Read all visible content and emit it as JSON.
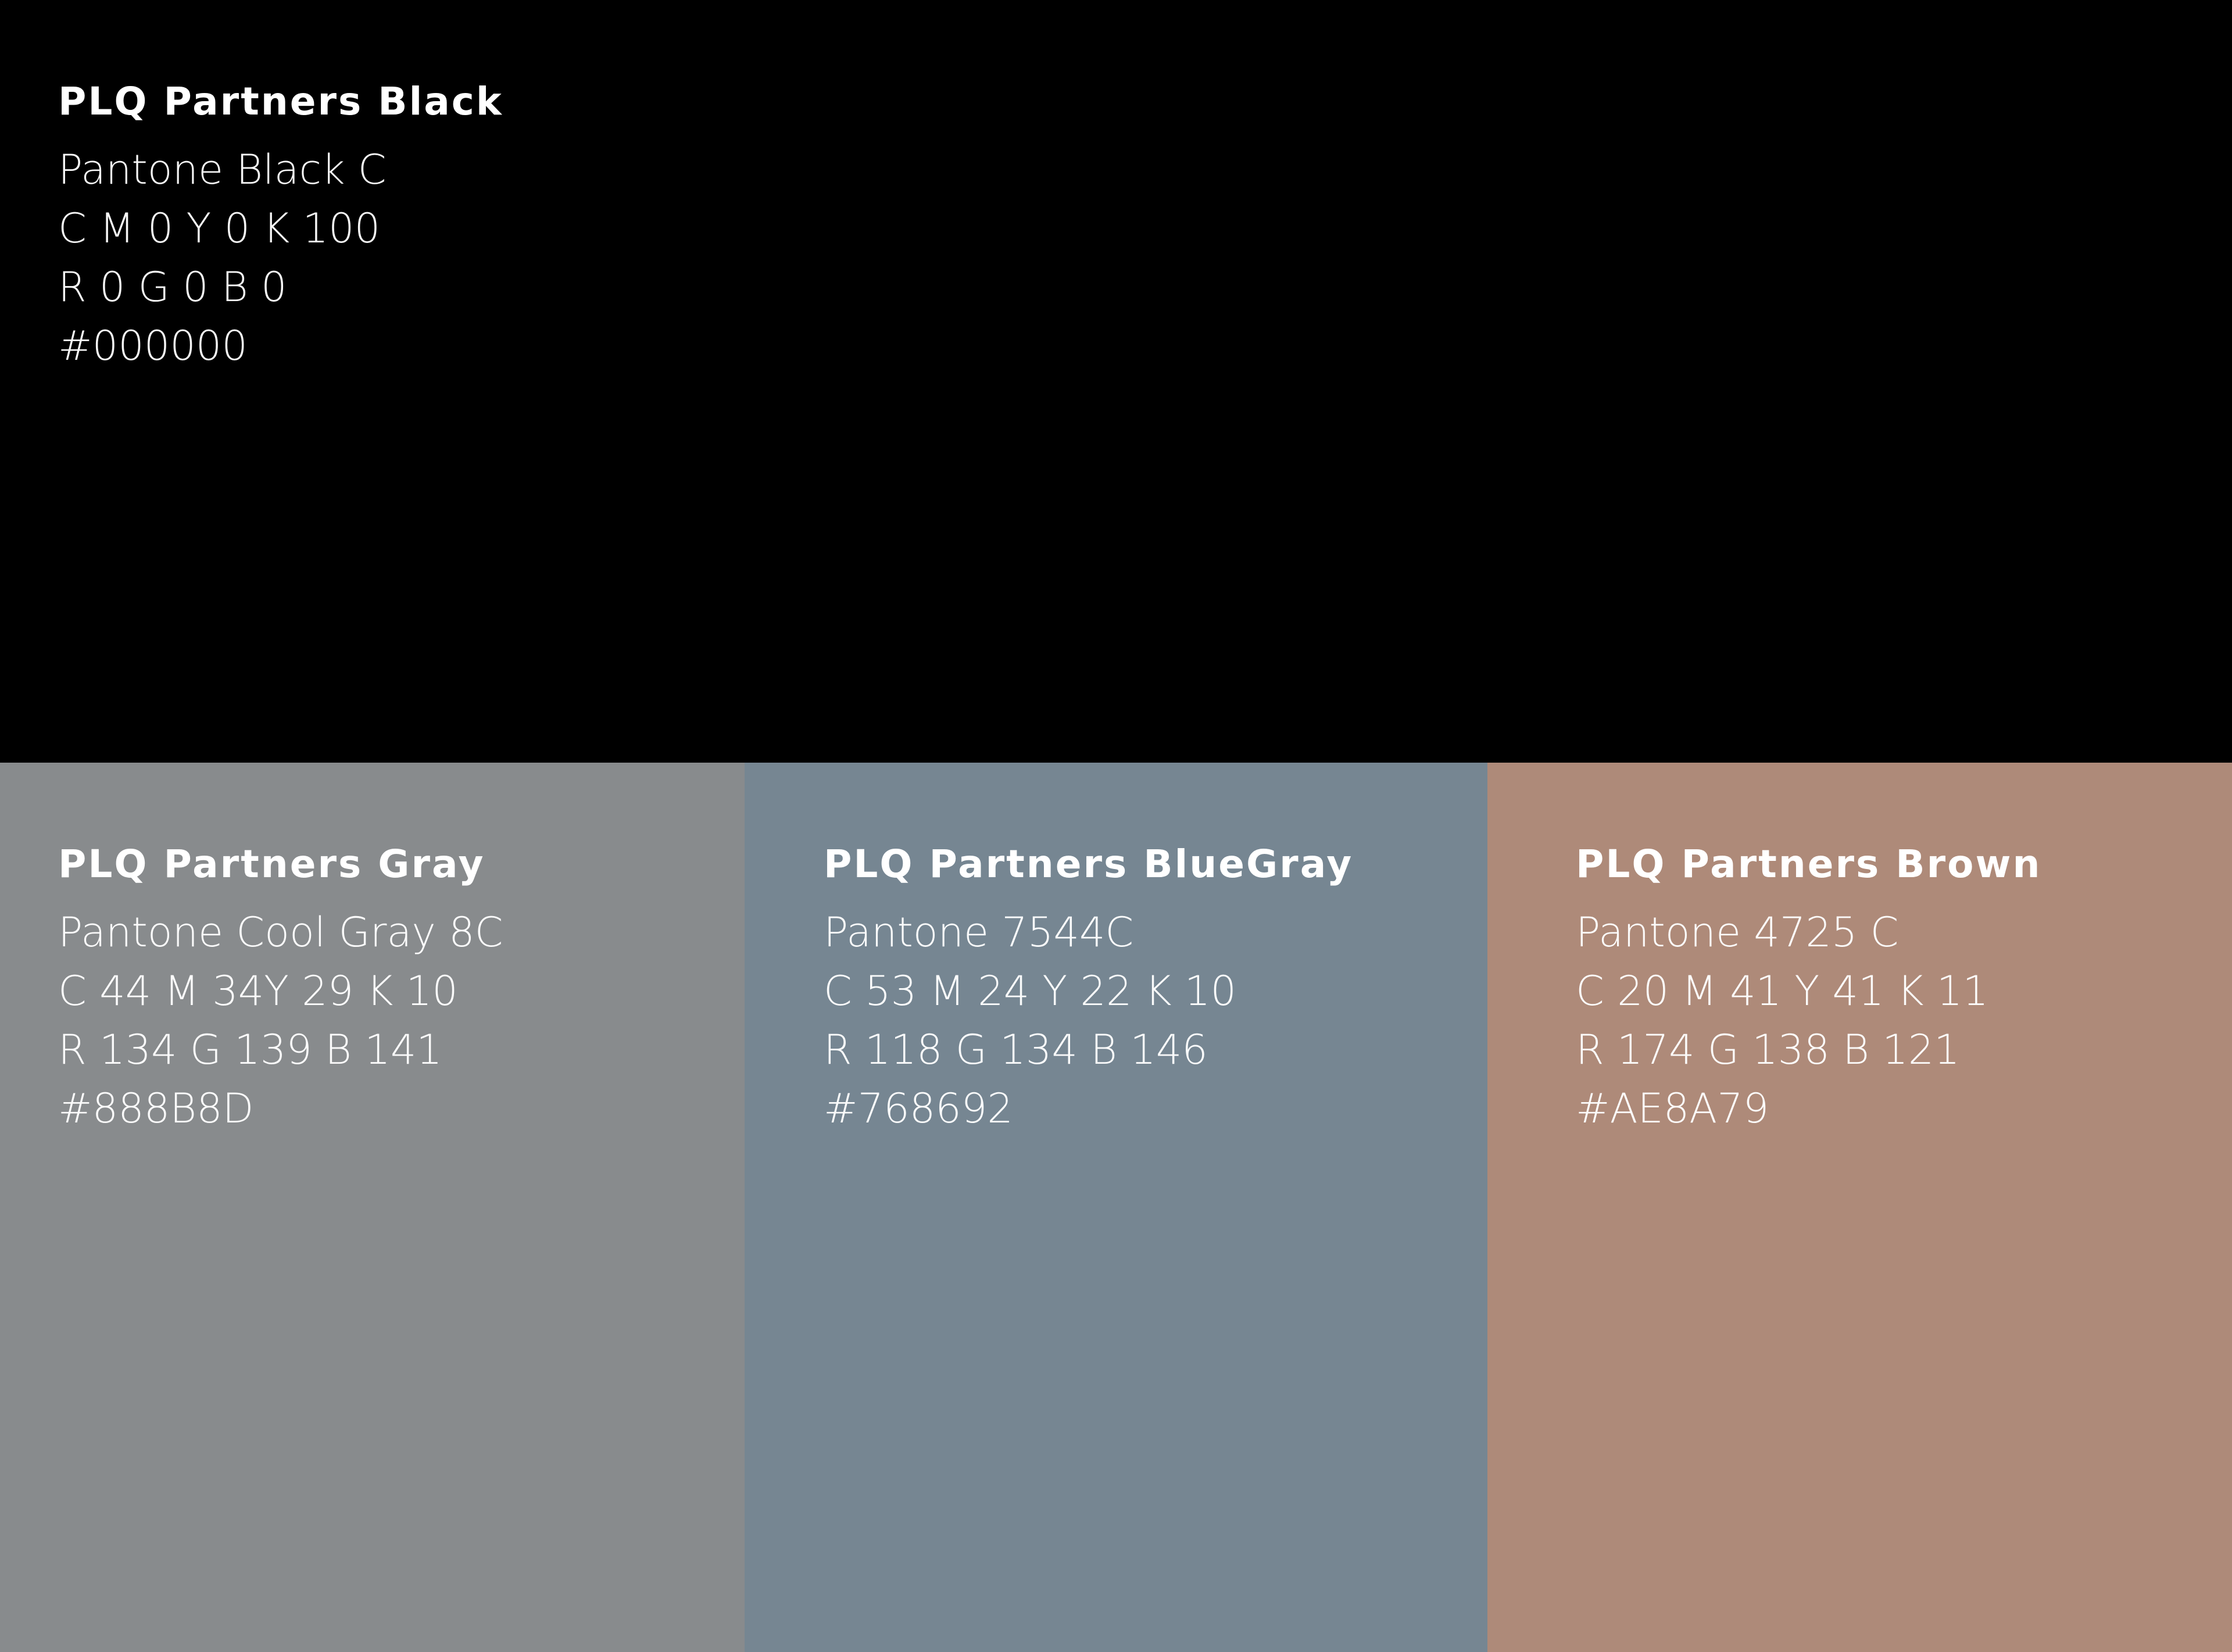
{
  "swatches": {
    "black": {
      "name": "PLQ Partners Black",
      "pantone": "Pantone Black C",
      "cmyk": "C  M 0 Y 0 K 100",
      "rgb": "R 0 G 0 B 0",
      "hex": "#000000",
      "color": "#000000"
    },
    "gray": {
      "name": "PLQ Partners Gray",
      "pantone": "Pantone Cool Gray 8C",
      "cmyk": "C 44 M 34Y 29 K 10",
      "rgb": "R 134  G 139  B 141",
      "hex": "#888B8D",
      "color": "#888B8D"
    },
    "bluegray": {
      "name": "PLQ Partners BlueGray",
      "pantone": "Pantone 7544C",
      "cmyk": "C 53 M 24 Y 22 K 10",
      "rgb": "R 118 G 134  B 146",
      "hex": "#768692",
      "color": "#768692"
    },
    "brown": {
      "name": "PLQ Partners Brown",
      "pantone": "Pantone 4725 C",
      "cmyk": "C 20 M 41 Y 41 K 11",
      "rgb": "R 174 G 138 B 121",
      "hex": "#AE8A79",
      "color": "#AE8A79"
    }
  }
}
